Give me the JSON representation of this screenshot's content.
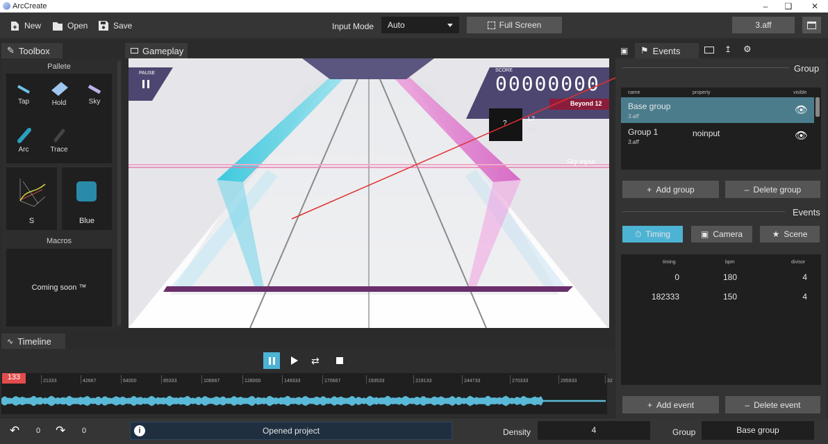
{
  "window": {
    "title": "ArcCreate"
  },
  "toolbar": {
    "new_label": "New",
    "open_label": "Open",
    "save_label": "Save",
    "input_mode_label": "Input Mode",
    "input_mode_value": "Auto",
    "fullscreen_label": "Full Screen",
    "file_label": "3.aff"
  },
  "toolbox": {
    "tab_label": "Toolbox",
    "palette_title": "Pallete",
    "tools": [
      "Tap",
      "Hold",
      "Sky",
      "Arc",
      "Trace"
    ],
    "arc_style_label": "S",
    "color_label": "Blue",
    "macros_title": "Macros",
    "macros_text": "Coming soon ™"
  },
  "gameplay": {
    "tab_label": "Gameplay",
    "pause_label": "PAUSE",
    "score_label": "SCORE",
    "score_value": "00000000",
    "difficulty": "Beyond 12",
    "jacket_char": "?",
    "song_title": "L7",
    "song_artist": "Ice",
    "sky_input_label": "Sky Input"
  },
  "timeline": {
    "tab_label": "Timeline",
    "current_marker": "133",
    "ticks": [
      "21333",
      "42667",
      "64000",
      "85333",
      "106667",
      "128000",
      "149333",
      "170667",
      "193533",
      "219133",
      "244733",
      "270333",
      "295933",
      "32"
    ]
  },
  "events_panel": {
    "tab_label": "Events",
    "group_title": "Group",
    "group_headers": {
      "name": "name",
      "property": "property",
      "visible": "visible"
    },
    "groups": [
      {
        "name": "Base group",
        "file": "3.aff",
        "property": ""
      },
      {
        "name": "Group 1",
        "file": "3.aff",
        "property": "noinput"
      }
    ],
    "add_group_label": "Add group",
    "delete_group_label": "Delete group",
    "events_title": "Events",
    "event_tabs": [
      "Timing",
      "Camera",
      "Scene"
    ],
    "timing_headers": {
      "timing": "timing",
      "bpm": "bpm",
      "divisor": "divisor"
    },
    "timing_rows": [
      {
        "timing": "0",
        "bpm": "180",
        "divisor": "4"
      },
      {
        "timing": "182333",
        "bpm": "150",
        "divisor": "4"
      }
    ],
    "add_event_label": "Add event",
    "delete_event_label": "Delete event"
  },
  "statusbar": {
    "undo_count": "0",
    "redo_count": "0",
    "message": "Opened project",
    "density_label": "Density",
    "density_value": "4",
    "group_label": "Group",
    "group_value": "Base group"
  },
  "colors": {
    "accent": "#4db3d4",
    "selected_row": "#4a7c8c",
    "marker": "#e24c4c"
  }
}
